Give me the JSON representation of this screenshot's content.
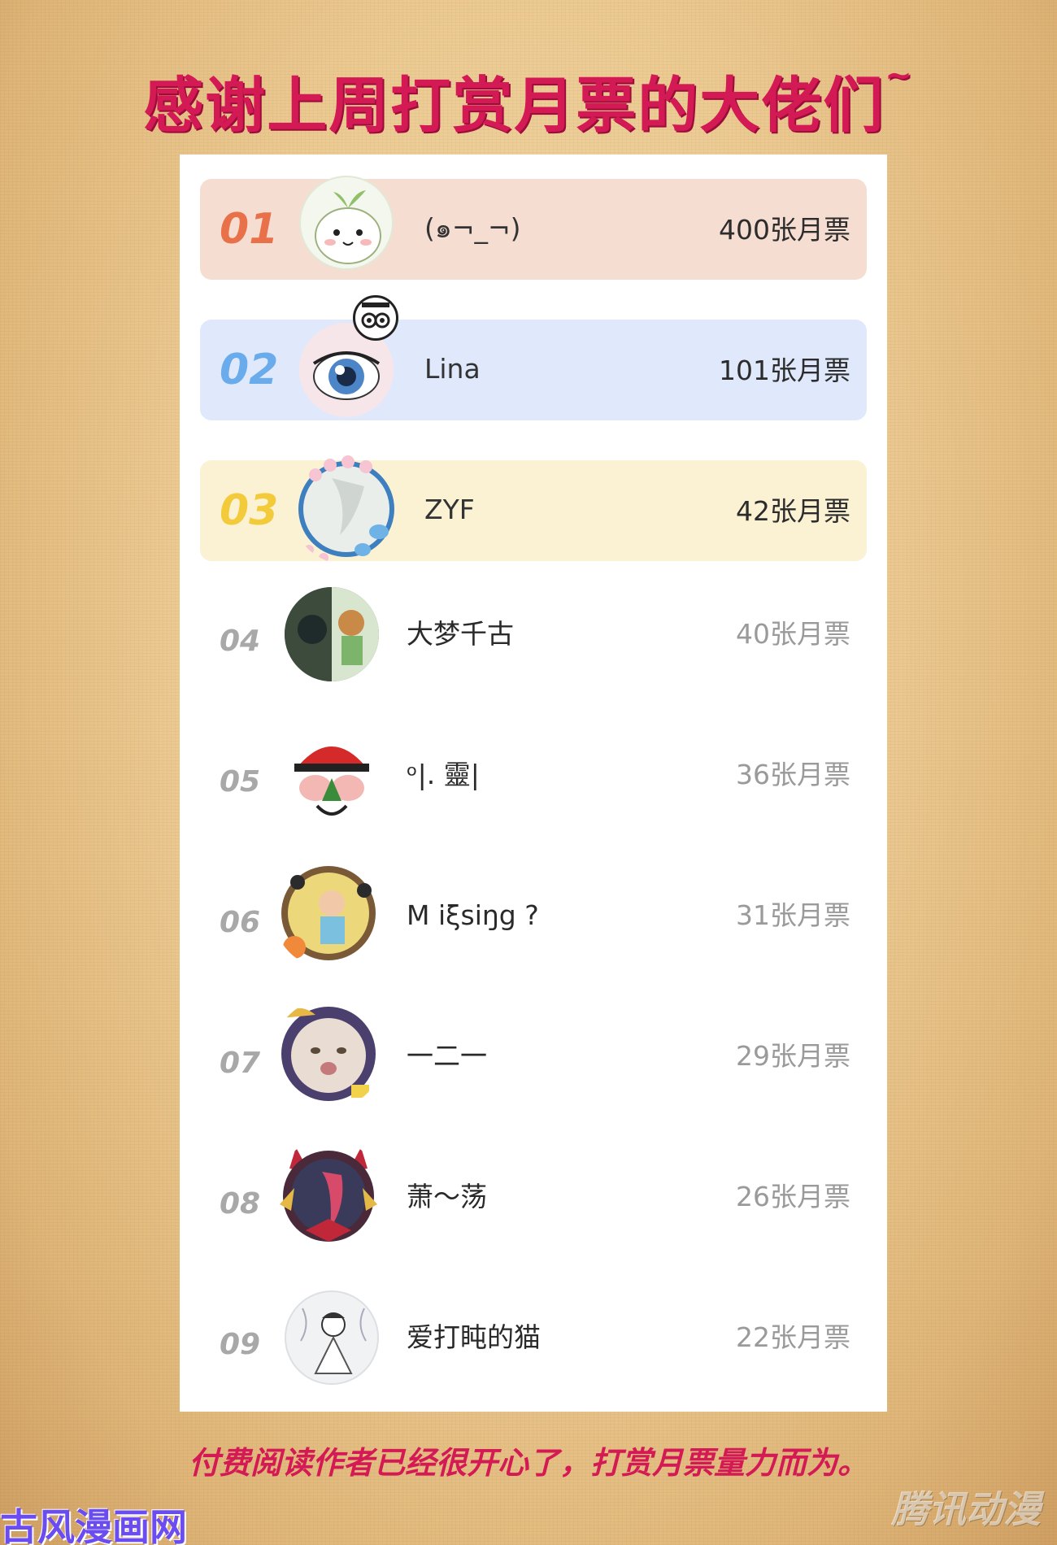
{
  "title": "感谢上周打赏月票的大佬们",
  "title_tilde": "~",
  "ranking": [
    {
      "rank": "01",
      "name": "(๑¬_¬)",
      "votes": "400张月票",
      "avatar_icon": "cartoon-sprout-avatar"
    },
    {
      "rank": "02",
      "name": "Lina",
      "votes": "101张月票",
      "avatar_icon": "anime-eye-avatar"
    },
    {
      "rank": "03",
      "name": "ZYF",
      "votes": "42张月票",
      "avatar_icon": "floral-frame-avatar"
    },
    {
      "rank": "04",
      "name": "大梦千古",
      "votes": "40张月票",
      "avatar_icon": "anime-character-avatar"
    },
    {
      "rank": "05",
      "name": "ᵒ|. 靈|",
      "votes": "36张月票",
      "avatar_icon": "red-hat-avatar"
    },
    {
      "rank": "06",
      "name": "M iξsiŋg ?",
      "votes": "31张月票",
      "avatar_icon": "child-photo-avatar"
    },
    {
      "rank": "07",
      "name": "一二一",
      "votes": "29张月票",
      "avatar_icon": "cat-photo-avatar"
    },
    {
      "rank": "08",
      "name": "萧～荡",
      "votes": "26张月票",
      "avatar_icon": "devil-frame-avatar"
    },
    {
      "rank": "09",
      "name": "爱打盹的猫",
      "votes": "22张月票",
      "avatar_icon": "sketch-avatar"
    }
  ],
  "footer": "付费阅读作者已经很开心了，打赏月票量力而为。",
  "watermark_left": "古风漫画网",
  "watermark_right": "腾讯动漫",
  "colors": {
    "title": "#d41a55",
    "rank1_bg": "#f6ddd2",
    "rank2_bg": "#dfe9fb",
    "rank3_bg": "#faf2d3",
    "rank1_num": "#e8714a",
    "rank2_num": "#6aabeb",
    "rank3_num": "#f3cb3a"
  }
}
